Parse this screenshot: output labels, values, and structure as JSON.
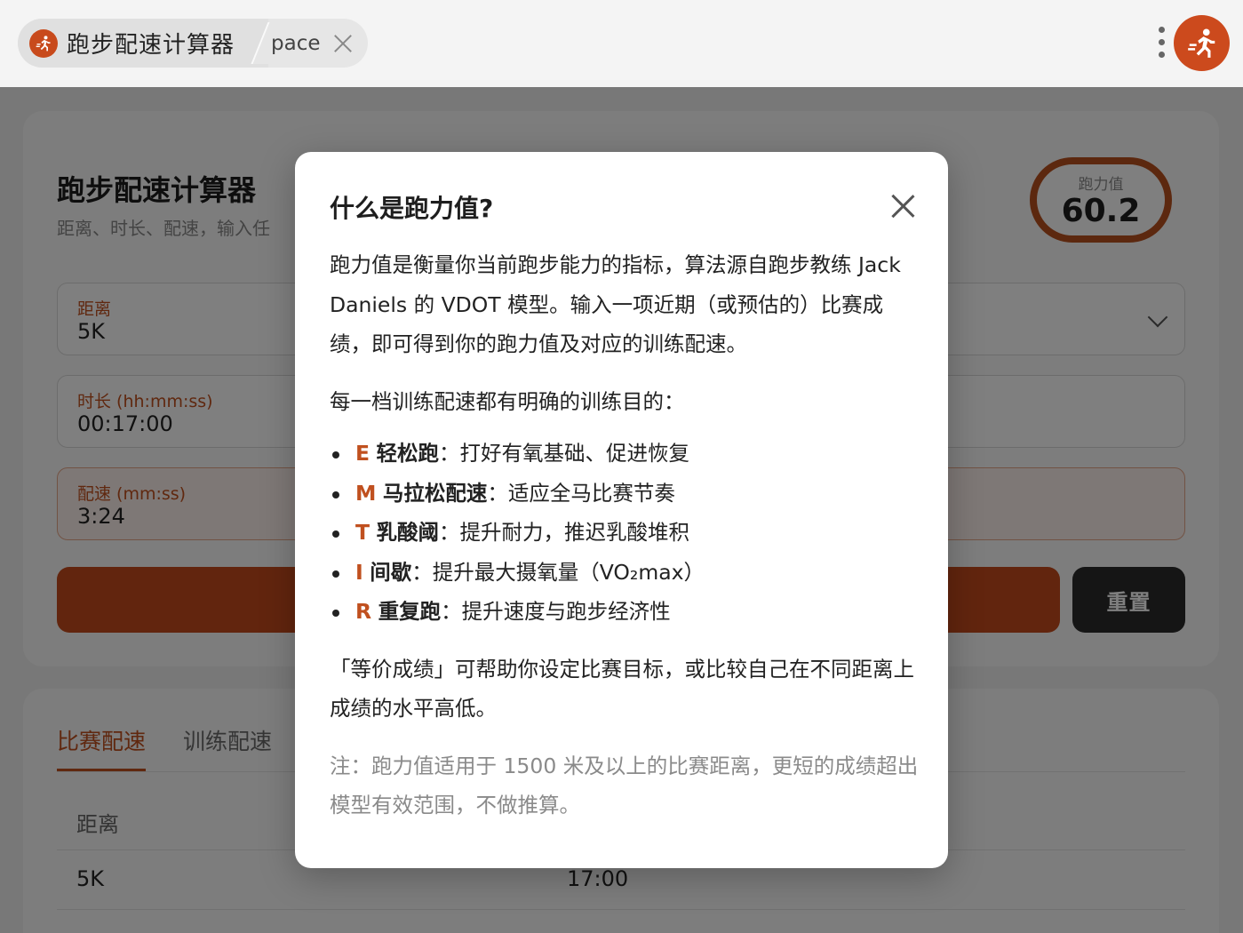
{
  "browser": {
    "tab_title": "跑步配速计算器",
    "search_query": "pace",
    "colors": {
      "accent": "#c84a1c"
    },
    "icons": [
      "runner-icon",
      "close-icon",
      "kebab-menu-icon"
    ]
  },
  "page": {
    "title": "跑步配速计算器",
    "subtitle": "距离、时长、配速，输入任",
    "vdot_label": "跑力值",
    "vdot_value": "60.2",
    "fields": {
      "distance": {
        "label": "距离",
        "value": "5K"
      },
      "duration": {
        "label": "时长 (hh:mm:ss)",
        "value": "00:17:00"
      },
      "pace": {
        "label": "配速 (mm:ss)",
        "value": "3:24"
      }
    },
    "reset_label": "重置",
    "result_tabs": [
      "比赛配速",
      "训练配速"
    ],
    "table": {
      "headers": [
        "距离"
      ],
      "rows": [
        {
          "distance": "5K",
          "time": "17:00"
        }
      ]
    }
  },
  "modal": {
    "title": "什么是跑力值?",
    "intro": "跑力值是衡量你当前跑步能力的指标，算法源自跑步教练 Jack Daniels 的 VDOT 模型。输入一项近期（或预估的）比赛成绩，即可得到你的跑力值及对应的训练配速。",
    "zones_heading": "每一档训练配速都有明确的训练目的：",
    "zones": [
      {
        "code": "E",
        "name": "轻松跑",
        "desc": "：打好有氧基础、促进恢复"
      },
      {
        "code": "M",
        "name": "马拉松配速",
        "desc": "：适应全马比赛节奏"
      },
      {
        "code": "T",
        "name": "乳酸阈",
        "desc": "：提升耐力，推迟乳酸堆积"
      },
      {
        "code": "I",
        "name": "间歇",
        "desc": "：提升最大摄氧量（VO₂max）"
      },
      {
        "code": "R",
        "name": "重复跑",
        "desc": "：提升速度与跑步经济性"
      }
    ],
    "equivalent": "「等价成绩」可帮助你设定比赛目标，或比较自己在不同距离上成绩的水平高低。",
    "note": "注：跑力值适用于 1500 米及以上的比赛距离，更短的成绩超出模型有效范围，不做推算。"
  }
}
